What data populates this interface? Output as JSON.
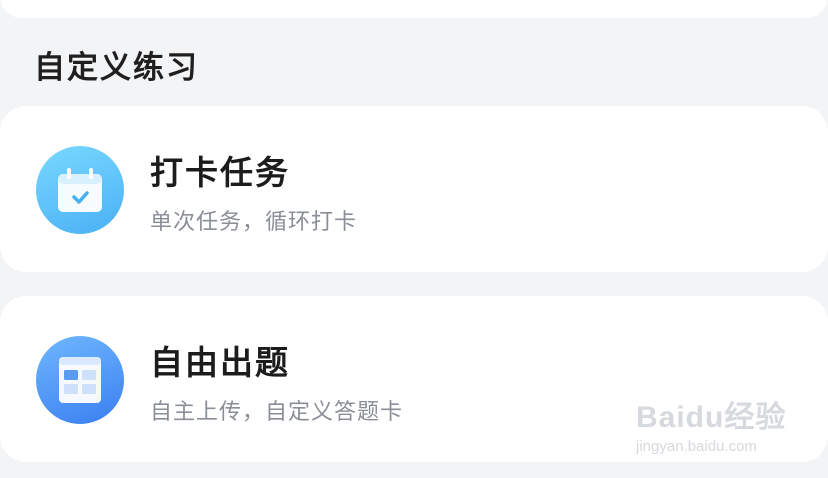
{
  "section": {
    "title": "自定义练习"
  },
  "cards": [
    {
      "title": "打卡任务",
      "subtitle": "单次任务，循环打卡",
      "icon": "calendar-check-icon"
    },
    {
      "title": "自由出题",
      "subtitle": "自主上传，自定义答题卡",
      "icon": "answer-sheet-icon"
    }
  ],
  "watermark": {
    "logo_text": "Baidu经验",
    "url": "jingyan.baidu.com"
  },
  "colors": {
    "background": "#f3f4f6",
    "card": "#ffffff",
    "title": "#1c1c1c",
    "subtitle": "#8a8e96",
    "icon1_gradient": [
      "#79d8ff",
      "#4ab0f5"
    ],
    "icon2_gradient": [
      "#6fb7ff",
      "#3a7ff0"
    ]
  }
}
